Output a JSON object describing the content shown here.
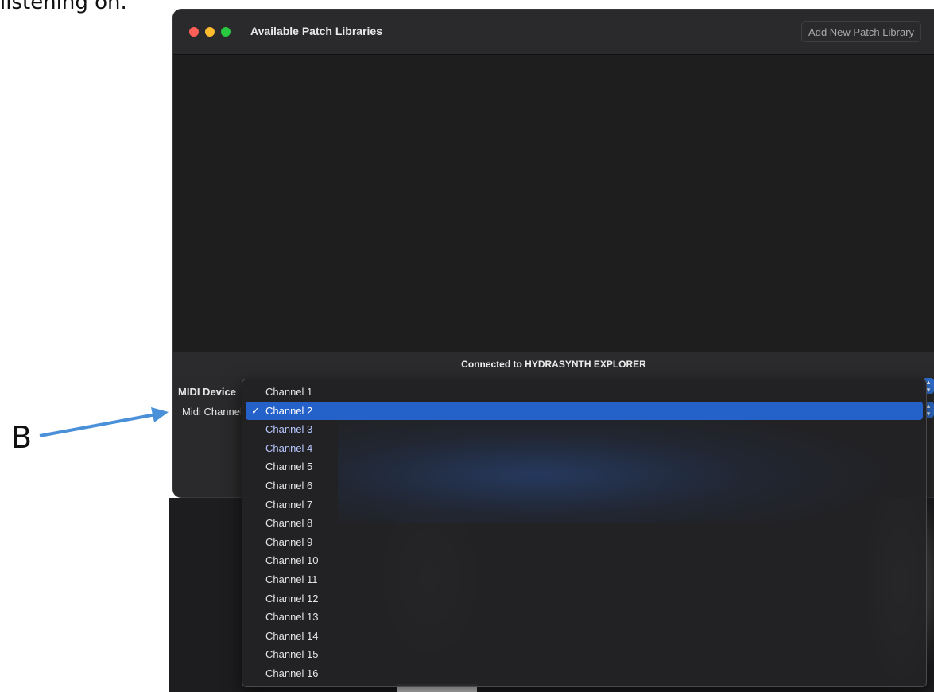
{
  "document": {
    "top_text": "listening on.",
    "callout_letter": "B"
  },
  "window": {
    "title": "Available Patch Libraries",
    "add_button_label": "Add New Patch Library",
    "status_text": "Connected to HYDRASYNTH EXPLORER"
  },
  "controls": {
    "midi_device_label": "MIDI Device",
    "midi_channel_label": "Midi Channel"
  },
  "dropdown": {
    "selected": "Channel 2",
    "checkmark": "✓",
    "items": [
      {
        "label": "Channel 1"
      },
      {
        "label": "Channel 2"
      },
      {
        "label": "Channel 3"
      },
      {
        "label": "Channel 4"
      },
      {
        "label": "Channel 5"
      },
      {
        "label": "Channel 6"
      },
      {
        "label": "Channel 7"
      },
      {
        "label": "Channel 8"
      },
      {
        "label": "Channel 9"
      },
      {
        "label": "Channel 10"
      },
      {
        "label": "Channel 11"
      },
      {
        "label": "Channel 12"
      },
      {
        "label": "Channel 13"
      },
      {
        "label": "Channel 14"
      },
      {
        "label": "Channel 15"
      },
      {
        "label": "Channel 16"
      }
    ]
  },
  "colors": {
    "selection": "#2461c9",
    "arrow": "#4a90d9",
    "window_bg": "#1e1e1f"
  },
  "icons": [
    "close-icon",
    "minimize-icon",
    "zoom-icon",
    "stepper-icon",
    "checkmark-icon",
    "arrow-icon"
  ]
}
